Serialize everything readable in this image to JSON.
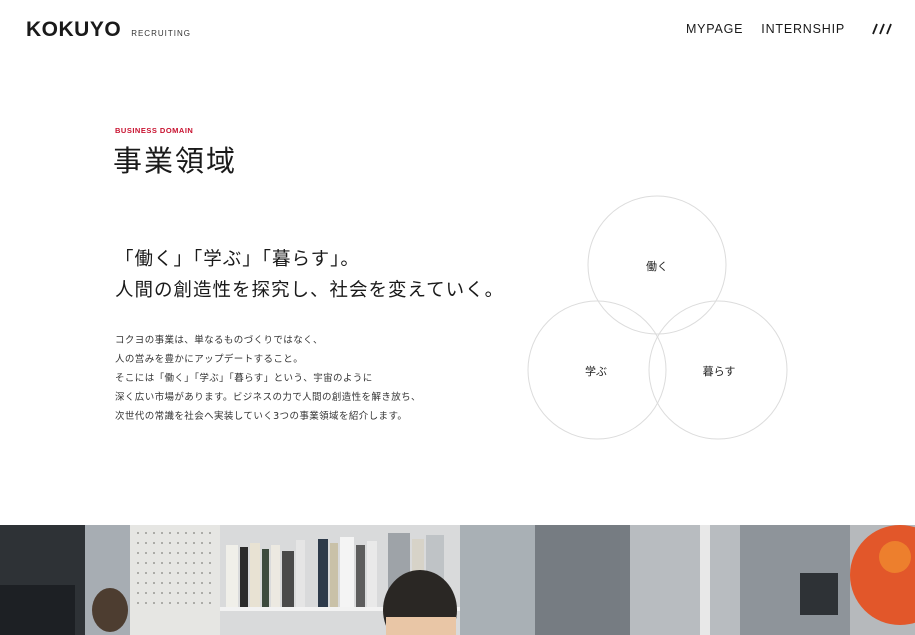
{
  "header": {
    "logo": "KOKUYO",
    "logo_sub": "RECRUITING",
    "nav": [
      {
        "label": "MYPAGE"
      },
      {
        "label": "INTERNSHIP"
      }
    ],
    "menu_icon": "menu-slashes-icon"
  },
  "section": {
    "eyebrow": "BUSINESS DOMAIN",
    "title": "事業領域",
    "lead": [
      "「働く」「学ぶ」「暮らす」。",
      "人間の創造性を探究し、社会を変えていく。"
    ],
    "body": [
      "コクヨの事業は、単なるものづくりではなく、",
      "人の営みを豊かにアップデートすること。",
      "そこには「働く」「学ぶ」「暮らす」という、宇宙のように",
      "深く広い市場があります。ビジネスの力で人間の創造性を解き放ち、",
      "次世代の常識を社会へ実装していく3つの事業領域を紹介します。"
    ]
  },
  "venn": {
    "circles": [
      {
        "label": "働く"
      },
      {
        "label": "学ぶ"
      },
      {
        "label": "暮らす"
      }
    ]
  },
  "colors": {
    "accent": "#c8102e",
    "text": "#1a1a1a",
    "circle_stroke": "#d9d9d9"
  }
}
